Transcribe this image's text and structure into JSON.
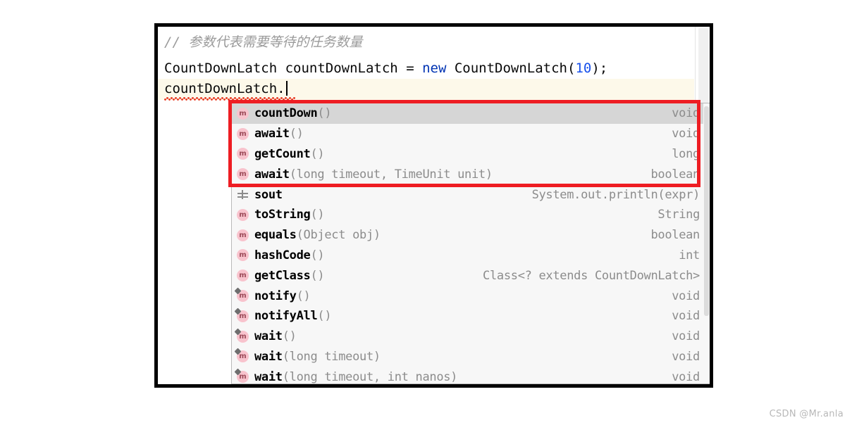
{
  "editor": {
    "comment_slashes": "// ",
    "comment_text": "参数代表需要等待的任务数量",
    "declaration": {
      "type_name": "CountDownLatch ",
      "var_name": "countDownLatch ",
      "equals": "= ",
      "keyword": "new",
      "ctor": " CountDownLatch(",
      "number": "10",
      "tail": ");"
    },
    "caret_line": "countDownLatch.",
    "current_line_bg": "#fdf9ea",
    "error_underline_color": "#e8402a",
    "keyword_color": "#0033b3",
    "number_color": "#1750eb",
    "comment_color": "#9a9a9a"
  },
  "completion": {
    "selected_index": 0,
    "selected_bg": "#d6d6d6",
    "row_bg": "#f7f7f7",
    "method_icon_bg": "#f8c3cd",
    "method_icon_glyph": "m",
    "items": [
      {
        "icon": "method-icon",
        "name": "countDown",
        "params": "()",
        "type": "void",
        "inherited": false
      },
      {
        "icon": "method-icon",
        "name": "await",
        "params": "()",
        "type": "void",
        "inherited": false
      },
      {
        "icon": "method-icon",
        "name": "getCount",
        "params": "()",
        "type": "long",
        "inherited": false
      },
      {
        "icon": "method-icon",
        "name": "await",
        "params": "(long timeout, TimeUnit unit)",
        "type": "boolean",
        "inherited": false
      },
      {
        "icon": "live-template-icon",
        "name": "sout",
        "params": "",
        "type": "System.out.println(expr)",
        "inherited": false
      },
      {
        "icon": "method-icon",
        "name": "toString",
        "params": "()",
        "type": "String",
        "inherited": false
      },
      {
        "icon": "method-icon",
        "name": "equals",
        "params": "(Object obj)",
        "type": "boolean",
        "inherited": false
      },
      {
        "icon": "method-icon",
        "name": "hashCode",
        "params": "()",
        "type": "int",
        "inherited": false
      },
      {
        "icon": "method-icon",
        "name": "getClass",
        "params": "()",
        "type": "Class<? extends CountDownLatch>",
        "inherited": false
      },
      {
        "icon": "method-icon",
        "name": "notify",
        "params": "()",
        "type": "void",
        "inherited": true
      },
      {
        "icon": "method-icon",
        "name": "notifyAll",
        "params": "()",
        "type": "void",
        "inherited": true
      },
      {
        "icon": "method-icon",
        "name": "wait",
        "params": "()",
        "type": "void",
        "inherited": true
      },
      {
        "icon": "method-icon",
        "name": "wait",
        "params": "(long timeout)",
        "type": "void",
        "inherited": true
      },
      {
        "icon": "method-icon",
        "name": "wait",
        "params": "(long timeout, int nanos)",
        "type": "void",
        "inherited": true
      }
    ]
  },
  "annotation": {
    "color": "#ee1d23",
    "covers_item_count": 4
  },
  "watermark": {
    "text": "CSDN @Mr.anla"
  }
}
